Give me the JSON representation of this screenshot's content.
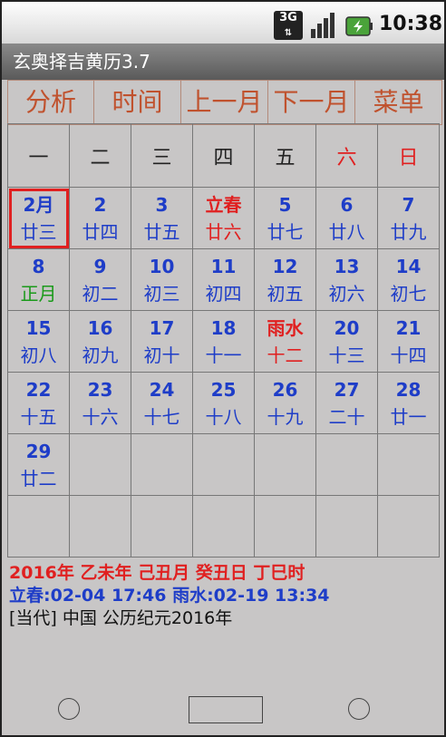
{
  "status_bar": {
    "network": "3G",
    "time": "10:38"
  },
  "app": {
    "title": "玄奥择吉黄历3.7"
  },
  "menu": [
    {
      "label": "分析",
      "w": 96
    },
    {
      "label": "时间",
      "w": 96
    },
    {
      "label": "上一月",
      "w": 96
    },
    {
      "label": "下一月",
      "w": 96
    },
    {
      "label": "菜单",
      "w": 96
    }
  ],
  "weekdays": [
    "一",
    "二",
    "三",
    "四",
    "五",
    "六",
    "日"
  ],
  "weeks": [
    [
      {
        "num": "2月",
        "lunar": "廿三",
        "selected": true
      },
      {
        "num": "2",
        "lunar": "廿四"
      },
      {
        "num": "3",
        "lunar": "廿五"
      },
      {
        "num": "立春",
        "lunar": "廿六",
        "red": true
      },
      {
        "num": "5",
        "lunar": "廿七"
      },
      {
        "num": "6",
        "lunar": "廿八"
      },
      {
        "num": "7",
        "lunar": "廿九"
      }
    ],
    [
      {
        "num": "8",
        "lunar": "正月",
        "green": true
      },
      {
        "num": "9",
        "lunar": "初二"
      },
      {
        "num": "10",
        "lunar": "初三"
      },
      {
        "num": "11",
        "lunar": "初四"
      },
      {
        "num": "12",
        "lunar": "初五"
      },
      {
        "num": "13",
        "lunar": "初六"
      },
      {
        "num": "14",
        "lunar": "初七"
      }
    ],
    [
      {
        "num": "15",
        "lunar": "初八"
      },
      {
        "num": "16",
        "lunar": "初九"
      },
      {
        "num": "17",
        "lunar": "初十"
      },
      {
        "num": "18",
        "lunar": "十一"
      },
      {
        "num": "雨水",
        "lunar": "十二",
        "red": true
      },
      {
        "num": "20",
        "lunar": "十三"
      },
      {
        "num": "21",
        "lunar": "十四"
      }
    ],
    [
      {
        "num": "22",
        "lunar": "十五"
      },
      {
        "num": "23",
        "lunar": "十六"
      },
      {
        "num": "24",
        "lunar": "十七"
      },
      {
        "num": "25",
        "lunar": "十八"
      },
      {
        "num": "26",
        "lunar": "十九"
      },
      {
        "num": "27",
        "lunar": "二十"
      },
      {
        "num": "28",
        "lunar": "廿一"
      }
    ],
    [
      {
        "num": "29",
        "lunar": "廿二"
      },
      {},
      {},
      {},
      {},
      {},
      {}
    ],
    [
      {},
      {},
      {},
      {},
      {},
      {},
      {}
    ]
  ],
  "info": {
    "line1": "2016年 乙未年 己丑月 癸丑日 丁巳时",
    "line2": "立春:02-04 17:46  雨水:02-19 13:34",
    "line3": "[当代] 中国  公历纪元2016年"
  }
}
